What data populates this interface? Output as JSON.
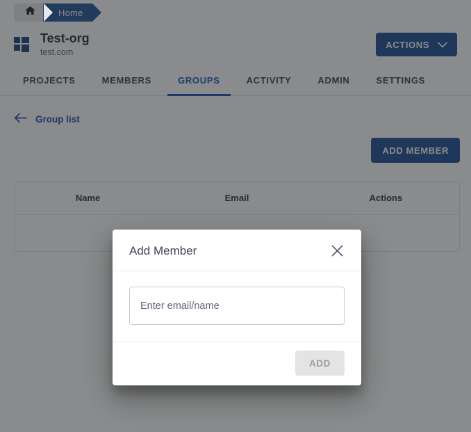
{
  "breadcrumb": {
    "home_icon": "home-icon",
    "items": [
      {
        "label": "Home"
      }
    ]
  },
  "org": {
    "logo_icon": "grid-squares-logo-icon",
    "name": "Test-org",
    "domain": "test.com",
    "actions_button": {
      "label": "ACTIONS",
      "icon": "chevron-down-icon"
    }
  },
  "tabs": [
    {
      "label": "PROJECTS",
      "active": false
    },
    {
      "label": "MEMBERS",
      "active": false
    },
    {
      "label": "GROUPS",
      "active": true
    },
    {
      "label": "ACTIVITY",
      "active": false
    },
    {
      "label": "ADMIN",
      "active": false
    },
    {
      "label": "SETTINGS",
      "active": false
    }
  ],
  "back_link": {
    "icon": "arrow-left-icon",
    "label": "Group list"
  },
  "toolbar": {
    "add_member_label": "ADD MEMBER"
  },
  "table": {
    "columns": [
      "Name",
      "Email",
      "Actions"
    ],
    "rows": []
  },
  "dialog": {
    "title": "Add Member",
    "close_icon": "close-icon",
    "input": {
      "placeholder": "Enter email/name",
      "value": ""
    },
    "confirm_label": "ADD",
    "confirm_disabled": true
  },
  "colors": {
    "primary_blue": "#1f4d95",
    "accent_blue": "#1a4fb5",
    "breadcrumb_blue": "#23559c",
    "link_blue": "#1d4fb0",
    "logo_blue": "#1d4487",
    "overlay": "rgba(33,35,38,0.53)",
    "disabled_button_bg": "#e4e4e4",
    "disabled_button_text": "#9c9c9c",
    "title_text": "#3f4458"
  }
}
